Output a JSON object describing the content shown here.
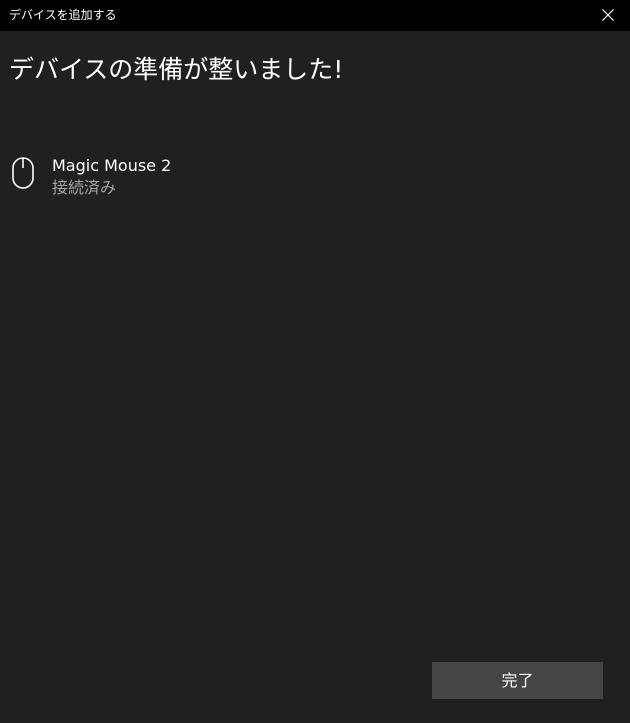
{
  "window": {
    "title": "デバイスを追加する",
    "close_icon": "close-icon"
  },
  "main": {
    "heading": "デバイスの準備が整いました!"
  },
  "device": {
    "icon": "mouse-icon",
    "name": "Magic Mouse 2",
    "status": "接続済み"
  },
  "footer": {
    "done_label": "完了"
  },
  "colors": {
    "background": "#202020",
    "titlebar": "#000000",
    "text": "#ffffff",
    "secondary_text": "#a6a6a6",
    "button": "#454545"
  }
}
